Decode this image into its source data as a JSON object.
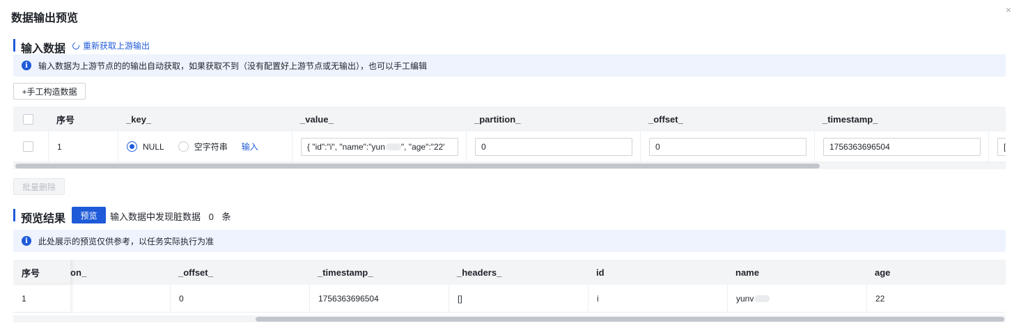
{
  "dialog": {
    "title": "数据输出预览",
    "close": "×"
  },
  "input_section": {
    "title": "输入数据",
    "refresh_label": "重新获取上游输出",
    "info": "输入数据为上游节点的的输出自动获取，如果获取不到（没有配置好上游节点或无输出），也可以手工编辑",
    "manual_button": "+手工构造数据",
    "batch_delete": "批量删除",
    "columns": [
      "序号",
      "_key_",
      "_value_",
      "_partition_",
      "_offset_",
      "_timestamp_"
    ],
    "row": {
      "index": "1",
      "key_option_null": "NULL",
      "key_option_empty": "空字符串",
      "key_input_link": "输入",
      "value": "{ \"id\":\"i\", \"name\":\"yun",
      "value_tail": "\", \"age\":\"22'",
      "partition": "0",
      "offset": "0",
      "timestamp": "1756363696504",
      "next_cell": "["
    }
  },
  "preview_section": {
    "title": "预览结果",
    "preview_button": "预览",
    "dirty_prefix": "输入数据中发现脏数据",
    "dirty_count": "0",
    "dirty_suffix": "条",
    "info": "此处展示的预览仅供参考，以任务实际执行为准",
    "columns": [
      "序号",
      "on_",
      "_offset_",
      "_timestamp_",
      "_headers_",
      "id",
      "name",
      "age"
    ],
    "row": {
      "index": "1",
      "partition": "",
      "offset": "0",
      "timestamp": "1756363696504",
      "headers": "[]",
      "id": "i",
      "name": "yunv",
      "age": "22"
    }
  },
  "colors": {
    "accent": "#1f5bd9",
    "info_bg": "#eef3fd",
    "header_bg": "#f3f4f6"
  }
}
